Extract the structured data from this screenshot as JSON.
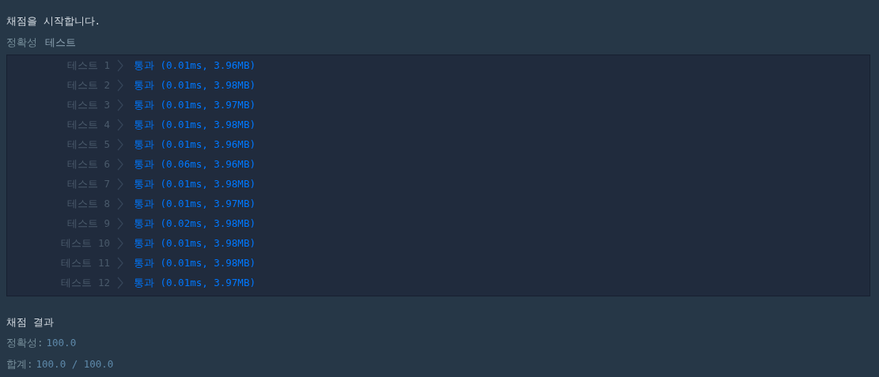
{
  "heading": "채점을 시작합니다.",
  "section_tabs": [
    "정확성",
    "테스트"
  ],
  "tests": [
    {
      "label": "테스트 1",
      "result": "통과 (0.01ms, 3.96MB)"
    },
    {
      "label": "테스트 2",
      "result": "통과 (0.01ms, 3.98MB)"
    },
    {
      "label": "테스트 3",
      "result": "통과 (0.01ms, 3.97MB)"
    },
    {
      "label": "테스트 4",
      "result": "통과 (0.01ms, 3.98MB)"
    },
    {
      "label": "테스트 5",
      "result": "통과 (0.01ms, 3.96MB)"
    },
    {
      "label": "테스트 6",
      "result": "통과 (0.06ms, 3.96MB)"
    },
    {
      "label": "테스트 7",
      "result": "통과 (0.01ms, 3.98MB)"
    },
    {
      "label": "테스트 8",
      "result": "통과 (0.01ms, 3.97MB)"
    },
    {
      "label": "테스트 9",
      "result": "통과 (0.02ms, 3.98MB)"
    },
    {
      "label": "테스트 10",
      "result": "통과 (0.01ms, 3.98MB)"
    },
    {
      "label": "테스트 11",
      "result": "통과 (0.01ms, 3.98MB)"
    },
    {
      "label": "테스트 12",
      "result": "통과 (0.01ms, 3.97MB)"
    }
  ],
  "result_title": "채점 결과",
  "summary": [
    {
      "label": "정확성:",
      "value": "100.0"
    },
    {
      "label": "합계:",
      "value": "100.0 / 100.0"
    }
  ]
}
